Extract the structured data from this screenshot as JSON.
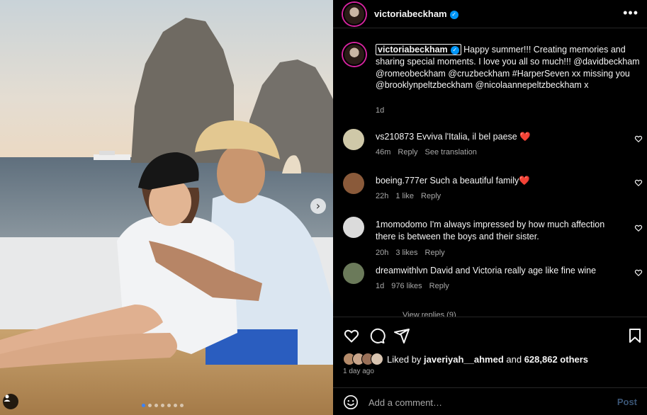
{
  "post": {
    "author": "victoriabeckham",
    "verified_icon": "verified-badge-icon",
    "more_icon": "more-options-icon"
  },
  "caption": {
    "username": "victoriabeckham",
    "text": "Happy summer!!! Creating memories and sharing special moments. I love you all so much!!! @davidbeckham @romeobeckham @cruzbeckham #HarperSeven xx missing you @brooklynpeltzbeckham @nicolaannepeltzbeckham x",
    "time": "1d"
  },
  "comments": [
    {
      "username": "vs210873",
      "text": "Evviva l'Italia, il bel paese ❤️",
      "time": "46m",
      "likes": "",
      "reply": "Reply",
      "extra": "See translation",
      "avatar_color": "#cfc8a8"
    },
    {
      "username": "boeing.777er",
      "text": "Such a beautiful family❤️",
      "time": "22h",
      "likes": "1 like",
      "reply": "Reply",
      "extra": "",
      "avatar_color": "#8a5a3a"
    },
    {
      "username": "1momodomo",
      "text": "I'm always impressed by how much affection there is between the boys and their sister.",
      "time": "20h",
      "likes": "3 likes",
      "reply": "Reply",
      "extra": "",
      "avatar_color": "#dbdbdb"
    },
    {
      "username": "dreamwithlvn",
      "text": "David and Victoria really age like fine wine",
      "time": "1d",
      "likes": "976 likes",
      "reply": "Reply",
      "extra": "",
      "avatar_color": "#6b7a5a"
    }
  ],
  "view_replies": "View replies (9)",
  "likes": {
    "prefix": "Liked by ",
    "user": "javeriyah__ahmed",
    "middle": " and ",
    "count": "628,862 others"
  },
  "post_age": "1 day ago",
  "comment_box": {
    "placeholder": "Add a comment…",
    "post_label": "Post"
  },
  "carousel": {
    "count": 7,
    "active_index": 0
  },
  "colors": {
    "accent": "#0095f6",
    "background": "#000000",
    "muted": "#a8a8a8",
    "like_red": "#ed4956"
  }
}
